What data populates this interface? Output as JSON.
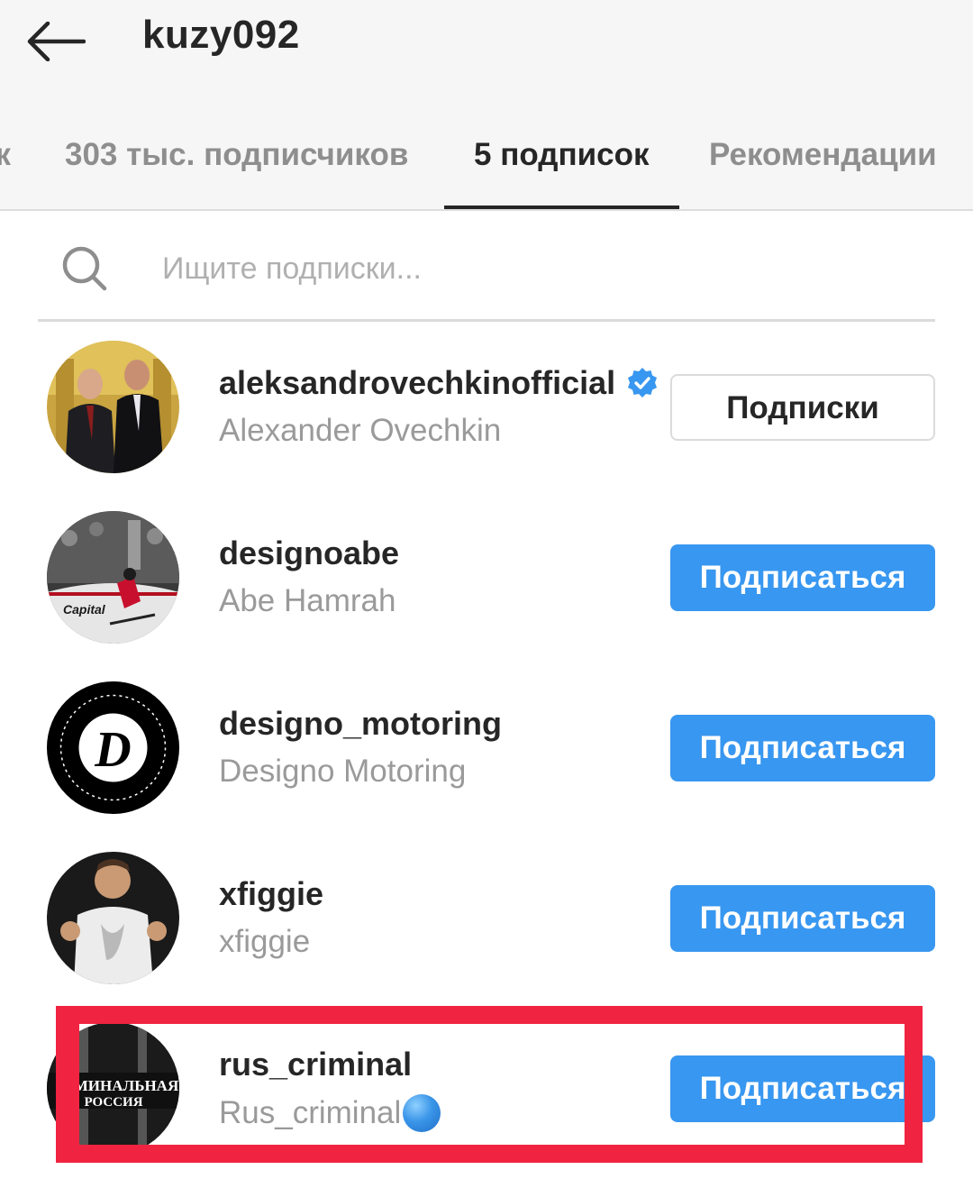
{
  "header": {
    "title": "kuzy092",
    "tabs": [
      {
        "label": "к",
        "active": false
      },
      {
        "label": "303 тыс. подписчиков",
        "active": false
      },
      {
        "label": "5 подписок",
        "active": true
      },
      {
        "label": "Рекомендации",
        "active": false
      }
    ]
  },
  "search": {
    "placeholder": "Ищите подписки..."
  },
  "list": [
    {
      "username": "aleksandrovechkinofficial",
      "fullname": "Alexander Ovechkin",
      "verified": true,
      "button": "Подписки",
      "button_state": "following"
    },
    {
      "username": "designoabe",
      "fullname": "Abe Hamrah",
      "verified": false,
      "button": "Подписаться",
      "button_state": "follow"
    },
    {
      "username": "designo_motoring",
      "fullname": "Designo Motoring",
      "verified": false,
      "button": "Подписаться",
      "button_state": "follow"
    },
    {
      "username": "xfiggie",
      "fullname": "xfiggie",
      "verified": false,
      "button": "Подписаться",
      "button_state": "follow"
    },
    {
      "username": "rus_criminal",
      "fullname": "Rus_criminal",
      "verified": false,
      "button": "Подписаться",
      "button_state": "follow"
    }
  ],
  "avatar_text": {
    "designoabe": "Capital",
    "designo_motoring": "D",
    "rus_criminal_line1": "МИНАЛЬНАЯ",
    "rus_criminal_line2": "РОССИЯ"
  },
  "icons": {
    "back": "arrow-left-icon",
    "search": "search-icon",
    "verified": "verified-badge-icon",
    "dot": "blue-circle-emoji"
  },
  "colors": {
    "accent": "#3897f0",
    "highlight": "#f02440",
    "text": "#262626",
    "secondary": "#9a9a9a"
  }
}
